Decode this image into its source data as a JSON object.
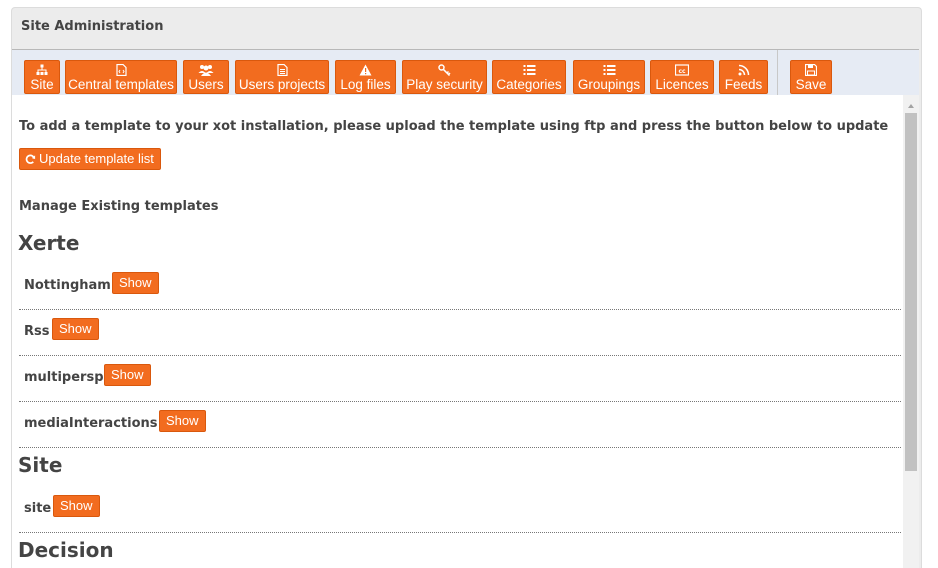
{
  "header": {
    "title": "Site Administration"
  },
  "toolbar": {
    "buttons": [
      {
        "label": "Site",
        "icon": "sitemap-icon"
      },
      {
        "label": "Central templates",
        "icon": "template-file-icon"
      },
      {
        "label": "Users",
        "icon": "users-icon"
      },
      {
        "label": "Users projects",
        "icon": "document-icon"
      },
      {
        "label": "Log files",
        "icon": "warning-icon"
      },
      {
        "label": "Play security",
        "icon": "key-icon"
      },
      {
        "label": "Categories",
        "icon": "list-icon"
      },
      {
        "label": "Groupings",
        "icon": "list-icon"
      },
      {
        "label": "Licences",
        "icon": "cc-icon"
      },
      {
        "label": "Feeds",
        "icon": "rss-icon"
      },
      {
        "label": "Save",
        "icon": "save-icon"
      }
    ],
    "accent_color": "#f26c1f"
  },
  "content": {
    "intro": "To add a template to your xot installation, please upload the template using ftp and press the button below to update",
    "update_button": "Update template list",
    "manage_heading": "Manage Existing templates",
    "groups": [
      {
        "title": "Xerte",
        "templates": [
          {
            "name": "Nottingham",
            "action": "Show"
          },
          {
            "name": "Rss",
            "action": "Show"
          },
          {
            "name": "multipersp",
            "action": "Show"
          },
          {
            "name": "mediaInteractions",
            "action": "Show"
          }
        ]
      },
      {
        "title": "Site",
        "templates": [
          {
            "name": "site",
            "action": "Show"
          }
        ]
      },
      {
        "title": "Decision",
        "templates": []
      }
    ]
  }
}
